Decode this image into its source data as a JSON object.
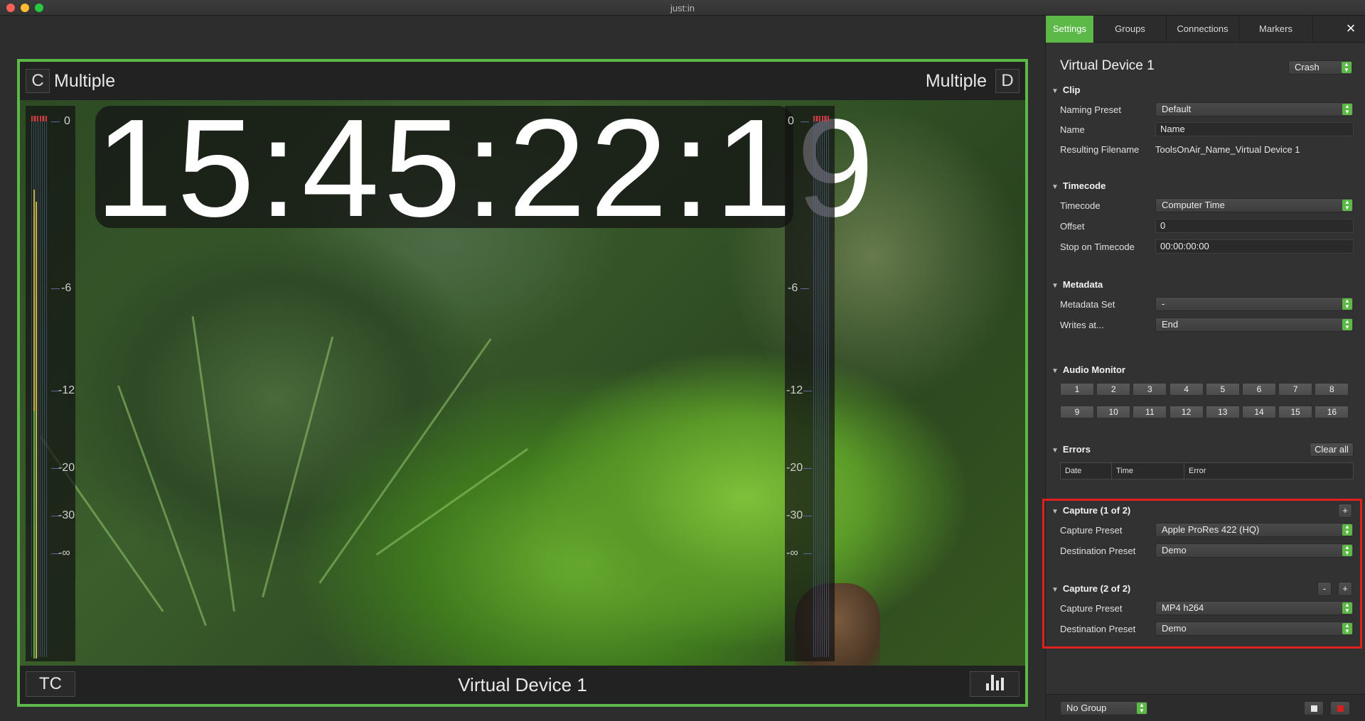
{
  "window": {
    "title": "just:in"
  },
  "preview": {
    "top_left_letter": "C",
    "top_left_label": "Multiple",
    "top_right_label": "Multiple",
    "top_right_letter": "D",
    "timecode": "15:45:22:19",
    "left_scale": [
      "0",
      "-6",
      "-12",
      "-20",
      "-30",
      "-∞"
    ],
    "right_scale": [
      "0",
      "-6",
      "-12",
      "-20",
      "-30",
      "-∞"
    ],
    "tc_button": "TC",
    "device_label": "Virtual Device 1",
    "meter_button_icon": "audio-levels-icon"
  },
  "panel": {
    "tabs": [
      "Settings",
      "Groups",
      "Connections",
      "Markers"
    ],
    "active_tab": "Settings",
    "close_icon": "×",
    "device_title": "Virtual Device 1",
    "device_mode": "Crash",
    "clip": {
      "header": "Clip",
      "naming_preset_label": "Naming Preset",
      "naming_preset_value": "Default",
      "name_label": "Name",
      "name_value": "Name",
      "resulting_filename_label": "Resulting Filename",
      "resulting_filename_value": "ToolsOnAir_Name_Virtual Device 1"
    },
    "timecode": {
      "header": "Timecode",
      "timecode_label": "Timecode",
      "timecode_value": "Computer Time",
      "offset_label": "Offset",
      "offset_value": "0",
      "stop_label": "Stop on Timecode",
      "stop_value": "00:00:00:00"
    },
    "metadata": {
      "header": "Metadata",
      "set_label": "Metadata Set",
      "set_value": "-",
      "writes_label": "Writes at...",
      "writes_value": "End"
    },
    "audio_monitor": {
      "header": "Audio Monitor",
      "channels": [
        "1",
        "2",
        "3",
        "4",
        "5",
        "6",
        "7",
        "8",
        "9",
        "10",
        "11",
        "12",
        "13",
        "14",
        "15",
        "16"
      ]
    },
    "errors": {
      "header": "Errors",
      "clear_all": "Clear all",
      "columns": [
        "Date",
        "Time",
        "Error"
      ]
    },
    "capture1": {
      "header": "Capture (1 of 2)",
      "add": "+",
      "capture_preset_label": "Capture Preset",
      "capture_preset_value": "Apple ProRes 422 (HQ)",
      "destination_preset_label": "Destination Preset",
      "destination_preset_value": "Demo"
    },
    "capture2": {
      "header": "Capture (2 of 2)",
      "remove": "-",
      "add": "+",
      "capture_preset_label": "Capture Preset",
      "capture_preset_value": "MP4 h264",
      "destination_preset_label": "Destination Preset",
      "destination_preset_value": "Demo"
    },
    "footer": {
      "group_value": "No Group"
    }
  },
  "colors": {
    "accent": "#5cb947",
    "highlight": "#e0201e",
    "record": "#d62020"
  }
}
